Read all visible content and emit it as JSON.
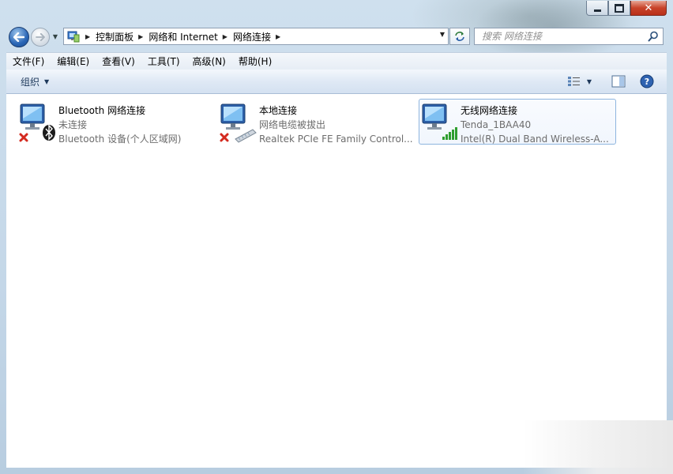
{
  "window": {
    "caption_buttons": [
      "minimize",
      "maximize",
      "close"
    ]
  },
  "address_bar": {
    "breadcrumbs": [
      {
        "label": "控制面板"
      },
      {
        "label": "网络和 Internet"
      },
      {
        "label": "网络连接"
      }
    ]
  },
  "search": {
    "placeholder": "搜索 网络连接"
  },
  "menu": {
    "items": [
      {
        "label": "文件(F)"
      },
      {
        "label": "编辑(E)"
      },
      {
        "label": "查看(V)"
      },
      {
        "label": "工具(T)"
      },
      {
        "label": "高级(N)"
      },
      {
        "label": "帮助(H)"
      }
    ]
  },
  "toolbar": {
    "organize_label": "组织",
    "icons": [
      "change-view-icon",
      "preview-pane-icon",
      "help-icon"
    ]
  },
  "connections": [
    {
      "name": "Bluetooth 网络连接",
      "status": "未连接",
      "device": "Bluetooth 设备(个人区域网)",
      "state": "disconnected",
      "adapter_icon": "bluetooth-icon"
    },
    {
      "name": "本地连接",
      "status": "网络电缆被拔出",
      "device": "Realtek PCIe FE Family Control...",
      "state": "disconnected",
      "adapter_icon": "ethernet-cable-icon"
    },
    {
      "name": "无线网络连接",
      "status": "Tenda_1BAA40",
      "device": "Intel(R) Dual Band Wireless-A...",
      "state": "connected",
      "adapter_icon": "wifi-signal-icon",
      "selected": true
    }
  ],
  "colors": {
    "accent": "#2a66b6",
    "selection_border": "#8eb5df",
    "error_x": "#d42a1f",
    "signal_green": "#2f9e2f"
  }
}
